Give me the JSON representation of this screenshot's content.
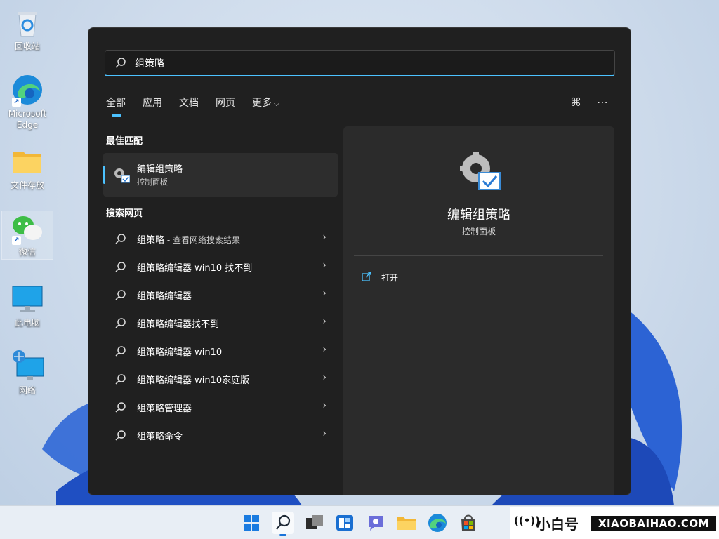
{
  "desktop": {
    "icons": [
      {
        "label": "回收站",
        "icon": "recycle-bin-icon"
      },
      {
        "label": "Microsoft Edge",
        "icon": "edge-icon"
      },
      {
        "label": "文件存放",
        "icon": "folder-icon"
      },
      {
        "label": "微信",
        "icon": "wechat-icon"
      },
      {
        "label": "此电脑",
        "icon": "computer-icon"
      },
      {
        "label": "网络",
        "icon": "network-icon"
      }
    ]
  },
  "search": {
    "query": "组策略",
    "tabs": [
      "全部",
      "应用",
      "文档",
      "网页",
      "更多"
    ],
    "more_chevron": "⌵",
    "share_icon": "⌘",
    "more_icon": "⋯",
    "best_match": {
      "section": "最佳匹配",
      "title": "编辑组策略",
      "subtitle": "控制面板"
    },
    "web_section": "搜索网页",
    "suggestions": [
      {
        "text": "组策略",
        "sub": " - 查看网络搜索结果"
      },
      {
        "text": "组策略编辑器 win10 找不到",
        "sub": ""
      },
      {
        "text": "组策略编辑器",
        "sub": ""
      },
      {
        "text": "组策略编辑器找不到",
        "sub": ""
      },
      {
        "text": "组策略编辑器 win10",
        "sub": ""
      },
      {
        "text": "组策略编辑器 win10家庭版",
        "sub": ""
      },
      {
        "text": "组策略管理器",
        "sub": ""
      },
      {
        "text": "组策略命令",
        "sub": ""
      }
    ],
    "arrow": "›",
    "detail": {
      "title": "编辑组策略",
      "subtitle": "控制面板",
      "action": "打开"
    }
  },
  "taskbar": {
    "items": [
      "windows-start",
      "search",
      "task-view",
      "widgets",
      "teams-chat",
      "file-explorer",
      "edge",
      "microsoft-store"
    ]
  },
  "watermark": {
    "symbol": "((•))",
    "cn": "小白号",
    "en": "XIAOBAIHAO.COM"
  },
  "colors": {
    "accent": "#4cc2ff",
    "panel": "#202020",
    "detail": "#2b2b2b"
  }
}
